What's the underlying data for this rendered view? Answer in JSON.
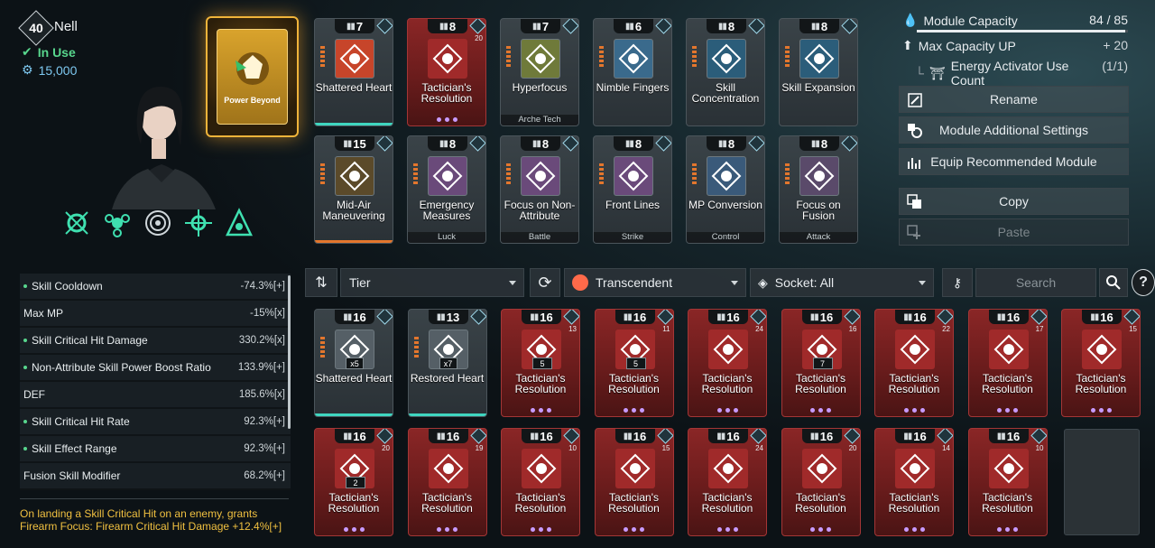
{
  "character": {
    "level": "40",
    "name": "Nell",
    "status": "In Use",
    "cost": "15,000"
  },
  "main_module": {
    "name": "Power Beyond"
  },
  "equipped": [
    {
      "rank": "7",
      "name": "Shattered Heart",
      "sub": "",
      "cap": "",
      "tone": "grey",
      "art": "#c7452a"
    },
    {
      "rank": "8",
      "name": "Tactician's Resolution",
      "sub": "",
      "cap": "20",
      "tone": "red",
      "art": "#8a1f1f"
    },
    {
      "rank": "7",
      "name": "Hyperfocus",
      "sub": "Arche Tech",
      "cap": "",
      "tone": "grey",
      "art": "#6f7a3a"
    },
    {
      "rank": "6",
      "name": "Nimble Fingers",
      "sub": "",
      "cap": "",
      "tone": "grey",
      "art": "#3a6a8c"
    },
    {
      "rank": "8",
      "name": "Skill Concentration",
      "sub": "",
      "cap": "",
      "tone": "grey",
      "art": "#2b5d7a"
    },
    {
      "rank": "8",
      "name": "Skill Expansion",
      "sub": "",
      "cap": "",
      "tone": "grey",
      "art": "#2b5d7a"
    },
    {
      "rank": "15",
      "name": "Mid-Air Maneuvering",
      "sub": "",
      "cap": "",
      "tone": "grey",
      "art": "#5b4a2a"
    },
    {
      "rank": "8",
      "name": "Emergency Measures",
      "sub": "Luck",
      "cap": "",
      "tone": "grey",
      "art": "#6a4a7a"
    },
    {
      "rank": "8",
      "name": "Focus on Non-Attribute",
      "sub": "Battle",
      "cap": "",
      "tone": "grey",
      "art": "#6a4a7a"
    },
    {
      "rank": "8",
      "name": "Front Lines",
      "sub": "Strike",
      "cap": "",
      "tone": "grey",
      "art": "#6a4a7a"
    },
    {
      "rank": "8",
      "name": "MP Conversion",
      "sub": "Control",
      "cap": "",
      "tone": "grey",
      "art": "#3a5a7a"
    },
    {
      "rank": "8",
      "name": "Focus on Fusion",
      "sub": "Attack",
      "cap": "",
      "tone": "grey",
      "art": "#5a4a6a"
    }
  ],
  "stats": [
    {
      "label": "Skill Cooldown",
      "value": "-74.3%[+]",
      "dot": true
    },
    {
      "label": "Max MP",
      "value": "-15%[x]",
      "dot": false
    },
    {
      "label": "Skill Critical Hit Damage",
      "value": "330.2%[x]",
      "dot": true
    },
    {
      "label": "Non-Attribute Skill Power Boost Ratio",
      "value": "133.9%[+]",
      "dot": true
    },
    {
      "label": "DEF",
      "value": "185.6%[x]",
      "dot": false
    },
    {
      "label": "Skill Critical Hit Rate",
      "value": "92.3%[+]",
      "dot": true
    },
    {
      "label": "Skill Effect Range",
      "value": "92.3%[+]",
      "dot": true
    },
    {
      "label": "Fusion Skill Modifier",
      "value": "68.2%[+]",
      "dot": false
    }
  ],
  "description": "On landing a Skill Critical Hit on an enemy, grants Firearm Focus: Firearm Critical Hit Damage +12.4%[+]",
  "capacity": {
    "label": "Module Capacity",
    "value": "84 / 85",
    "used": 84,
    "max": 85,
    "max_up_label": "Max Capacity UP",
    "max_up_value": "+ 20",
    "energy_label": "Energy Activator Use Count",
    "energy_value": "(1/1)"
  },
  "buttons": {
    "rename": "Rename",
    "additional": "Module Additional Settings",
    "recommend": "Equip Recommended Module",
    "copy": "Copy",
    "paste": "Paste"
  },
  "filters": {
    "sort": "Tier",
    "rarity": "Transcendent",
    "socket": "Socket: All",
    "search_placeholder": "Search"
  },
  "inventory": [
    {
      "rank": "16",
      "name": "Shattered Heart",
      "tone": "grey",
      "qty": "x5",
      "cap": "",
      "gauge": ""
    },
    {
      "rank": "13",
      "name": "Restored Heart",
      "tone": "grey",
      "qty": "x7",
      "cap": "",
      "gauge": ""
    },
    {
      "rank": "16",
      "name": "Tactician's Resolution",
      "tone": "red",
      "qty": "",
      "cap": "13",
      "gauge": "5"
    },
    {
      "rank": "16",
      "name": "Tactician's Resolution",
      "tone": "red",
      "qty": "",
      "cap": "11",
      "gauge": "5"
    },
    {
      "rank": "16",
      "name": "Tactician's Resolution",
      "tone": "red",
      "qty": "",
      "cap": "24",
      "gauge": ""
    },
    {
      "rank": "16",
      "name": "Tactician's Resolution",
      "tone": "red",
      "qty": "",
      "cap": "16",
      "gauge": "7"
    },
    {
      "rank": "16",
      "name": "Tactician's Resolution",
      "tone": "red",
      "qty": "",
      "cap": "22",
      "gauge": ""
    },
    {
      "rank": "16",
      "name": "Tactician's Resolution",
      "tone": "red",
      "qty": "",
      "cap": "17",
      "gauge": ""
    },
    {
      "rank": "16",
      "name": "Tactician's Resolution",
      "tone": "red",
      "qty": "",
      "cap": "15",
      "gauge": ""
    },
    {
      "rank": "16",
      "name": "Tactician's Resolution",
      "tone": "red",
      "qty": "",
      "cap": "20",
      "gauge": "2"
    },
    {
      "rank": "16",
      "name": "Tactician's Resolution",
      "tone": "red",
      "qty": "",
      "cap": "19",
      "gauge": ""
    },
    {
      "rank": "16",
      "name": "Tactician's Resolution",
      "tone": "red",
      "qty": "",
      "cap": "10",
      "gauge": ""
    },
    {
      "rank": "16",
      "name": "Tactician's Resolution",
      "tone": "red",
      "qty": "",
      "cap": "15",
      "gauge": ""
    },
    {
      "rank": "16",
      "name": "Tactician's Resolution",
      "tone": "red",
      "qty": "",
      "cap": "24",
      "gauge": ""
    },
    {
      "rank": "16",
      "name": "Tactician's Resolution",
      "tone": "red",
      "qty": "",
      "cap": "20",
      "gauge": ""
    },
    {
      "rank": "16",
      "name": "Tactician's Resolution",
      "tone": "red",
      "qty": "",
      "cap": "14",
      "gauge": ""
    },
    {
      "rank": "16",
      "name": "Tactician's Resolution",
      "tone": "red",
      "qty": "",
      "cap": "10",
      "gauge": ""
    }
  ],
  "colors": {
    "accent_gold": "#f0b43a",
    "in_use": "#58d68d",
    "stat_dot": "#58d68d",
    "desc": "#f0c040",
    "rarity": "#ff6a4a"
  }
}
